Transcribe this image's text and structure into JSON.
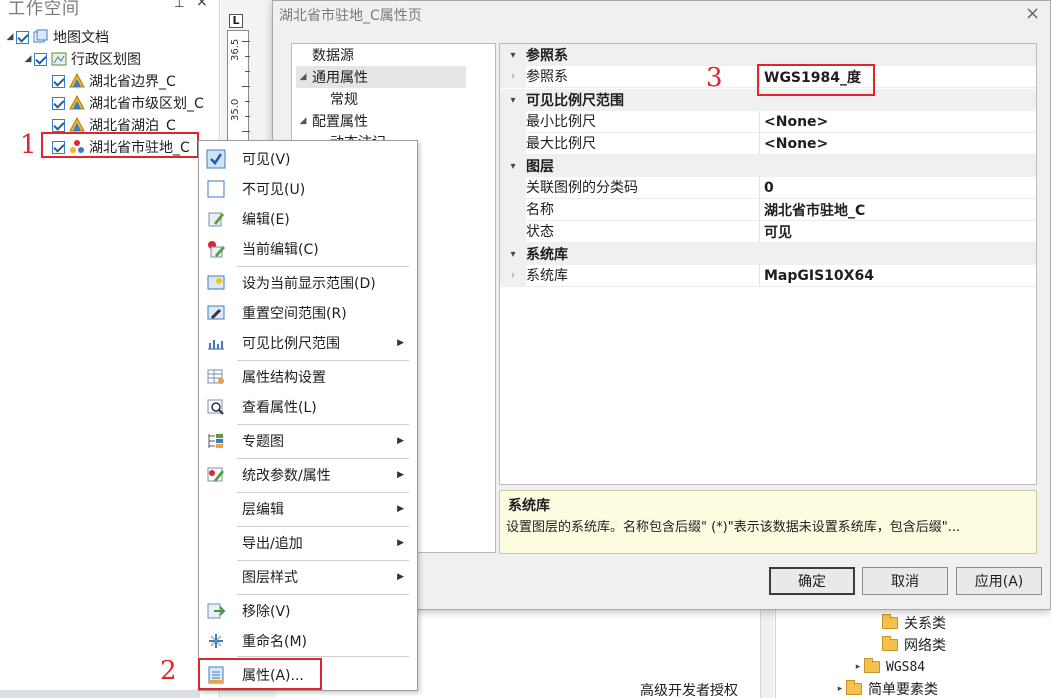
{
  "workspace": {
    "title": "工作空间",
    "pin": "⊥",
    "close": "×",
    "tree": {
      "root": "地图文档",
      "map": "行政区划图",
      "layers": [
        "湖北省边界_C",
        "湖北省市级区划_C",
        "湖北省湖泊_C",
        "湖北省市驻地_C"
      ]
    }
  },
  "ruler": {
    "corner": "L",
    "marks": [
      "36.5",
      "35.0"
    ]
  },
  "dialog": {
    "title": "湖北省市驻地_C属性页",
    "close": "×",
    "nav": [
      "数据源",
      "通用属性",
      "常规",
      "配置属性",
      "动态注记"
    ],
    "grid": {
      "cat_reference": "参照系",
      "row_reference": {
        "name": "参照系",
        "value": "WGS1984_度"
      },
      "cat_scale": "可见比例尺范围",
      "row_min_scale": {
        "name": "最小比例尺",
        "value": "<None>"
      },
      "row_max_scale": {
        "name": "最大比例尺",
        "value": "<None>"
      },
      "cat_layer": "图层",
      "row_legend_code": {
        "name": "关联图例的分类码",
        "value": "0"
      },
      "row_layer_name": {
        "name": "名称",
        "value": "湖北省市驻地_C"
      },
      "row_state": {
        "name": "状态",
        "value": "可见"
      },
      "cat_lib": "系统库",
      "row_lib": {
        "name": "系统库",
        "value": "MapGIS10X64"
      }
    },
    "description": {
      "title": "系统库",
      "text": "设置图层的系统库。名称包含后缀\" (*)\"表示该数据未设置系统库，包含后缀\"..."
    },
    "buttons": {
      "ok": "确定",
      "cancel": "取消",
      "apply": "应用(A)"
    }
  },
  "menu": {
    "items": [
      {
        "label": "可见(V)"
      },
      {
        "label": "不可见(U)"
      },
      {
        "label": "编辑(E)"
      },
      {
        "label": "当前编辑(C)"
      },
      {
        "label": "设为当前显示范围(D)"
      },
      {
        "label": "重置空间范围(R)"
      },
      {
        "label": "可见比例尺范围"
      },
      {
        "label": "属性结构设置"
      },
      {
        "label": "查看属性(L)"
      },
      {
        "label": "专题图"
      },
      {
        "label": "统改参数/属性"
      },
      {
        "label": "层编辑"
      },
      {
        "label": "导出/追加"
      },
      {
        "label": "图层样式"
      },
      {
        "label": "移除(V)"
      },
      {
        "label": "重命名(M)"
      },
      {
        "label": "属性(A)..."
      }
    ],
    "submenu_arrow": "▶"
  },
  "catalog": {
    "items": [
      "关系类",
      "网络类",
      "WGS84",
      "简单要素类"
    ],
    "status": "高级开发者授权"
  },
  "steps": [
    "1",
    "2",
    "3"
  ],
  "colors": {
    "highlight": "#e0262d",
    "accent": "#3b7dc4"
  }
}
